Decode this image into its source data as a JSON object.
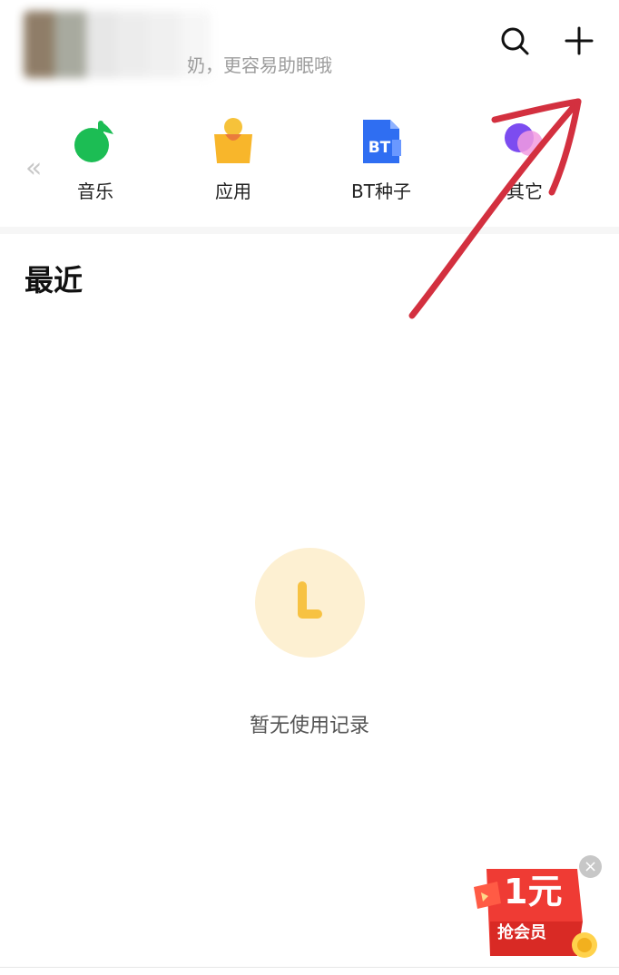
{
  "header": {
    "tip_text": "奶，更容易助眠哦",
    "search_icon": "search-icon",
    "add_icon": "plus-icon"
  },
  "categories": [
    {
      "label": "音乐",
      "icon": "music-note-icon",
      "color": "#1cbd54"
    },
    {
      "label": "应用",
      "icon": "shopping-bag-icon",
      "color": "#f8b62b"
    },
    {
      "label": "BT种子",
      "icon": "bt-file-icon",
      "color": "#2f6ef2"
    },
    {
      "label": "其它",
      "icon": "other-circles-icon",
      "color": "#7c4cf0"
    }
  ],
  "back_arrows": "«",
  "recent": {
    "title": "最近",
    "empty_text": "暂无使用记录",
    "empty_icon": "clock-icon"
  },
  "promo": {
    "big_text": "1元",
    "sub_text": "抢会员",
    "close_icon": "close-icon",
    "close_glyph": "×"
  },
  "annotation": {
    "color": "#d3303f",
    "icon": "red-arrow-annotation"
  }
}
